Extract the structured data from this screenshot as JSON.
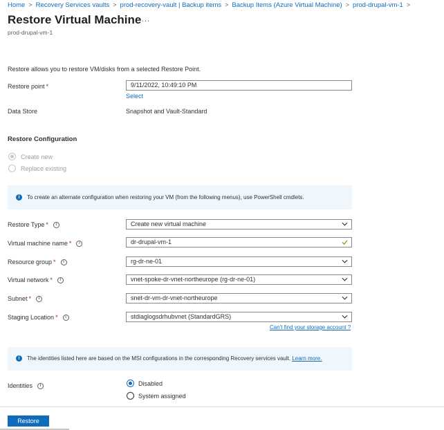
{
  "breadcrumb": [
    "Home",
    "Recovery Services vaults",
    "prod-recovery-vault | Backup items",
    "Backup Items (Azure Virtual Machine)",
    "prod-drupal-vm-1"
  ],
  "header": {
    "title": "Restore Virtual Machine",
    "subtitle": "prod-drupal-vm-1",
    "more": "..."
  },
  "intro": "Restore allows you to restore VM/disks from a selected Restore Point.",
  "restore_point": {
    "label": "Restore point",
    "value": "9/11/2022, 10:49:10 PM",
    "select_link": "Select"
  },
  "data_store": {
    "label": "Data Store",
    "value": "Snapshot and Vault-Standard"
  },
  "restore_config": {
    "heading": "Restore Configuration",
    "options": [
      {
        "label": "Create new",
        "checked": true,
        "disabled": true
      },
      {
        "label": "Replace existing",
        "checked": false,
        "disabled": true
      }
    ]
  },
  "banner1": {
    "text": "To create an alternate configuration when restoring your VM (from the following menus), use PowerShell cmdlets."
  },
  "form": {
    "restore_type": {
      "label": "Restore Type",
      "value": "Create new virtual machine"
    },
    "vm_name": {
      "label": "Virtual machine name",
      "value": "dr-drupal-vm-1"
    },
    "resource_group": {
      "label": "Resource group",
      "value": "rg-dr-ne-01"
    },
    "virtual_network": {
      "label": "Virtual network",
      "value": "vnet-spoke-dr-vnet-northeurope (rg-dr-ne-01)"
    },
    "subnet": {
      "label": "Subnet",
      "value": "snet-dr-vm-dr-vnet-northeurope"
    },
    "staging_location": {
      "label": "Staging Location",
      "value": "stdiaglogsdrhubvnet (StandardGRS)"
    },
    "storage_link": "Can't find your storage account ?"
  },
  "required_mark": "*",
  "banner2": {
    "text": "The identities listed here are based on the MSI configurations in the corresponding Recovery services vault.",
    "link": "Learn more."
  },
  "identities": {
    "label": "Identities",
    "options": [
      {
        "label": "Disabled",
        "checked": true
      },
      {
        "label": "System assigned",
        "checked": false
      }
    ]
  },
  "footer": {
    "restore_button": "Restore"
  },
  "colors": {
    "accent": "#0f6cbd",
    "banner_bg": "#eff6fc",
    "required": "#a4262c",
    "success": "#57a300"
  }
}
